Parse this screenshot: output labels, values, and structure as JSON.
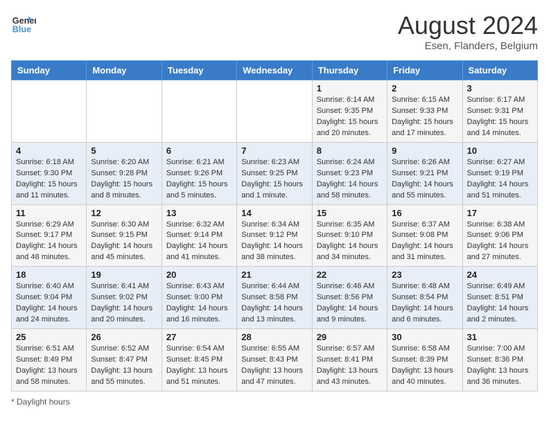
{
  "header": {
    "logo_line1": "General",
    "logo_line2": "Blue",
    "month_year": "August 2024",
    "location": "Esen, Flanders, Belgium"
  },
  "weekdays": [
    "Sunday",
    "Monday",
    "Tuesday",
    "Wednesday",
    "Thursday",
    "Friday",
    "Saturday"
  ],
  "footer": {
    "daylight_label": "Daylight hours"
  },
  "weeks": [
    [
      {
        "day": "",
        "info": ""
      },
      {
        "day": "",
        "info": ""
      },
      {
        "day": "",
        "info": ""
      },
      {
        "day": "",
        "info": ""
      },
      {
        "day": "1",
        "info": "Sunrise: 6:14 AM\nSunset: 9:35 PM\nDaylight: 15 hours\nand 20 minutes."
      },
      {
        "day": "2",
        "info": "Sunrise: 6:15 AM\nSunset: 9:33 PM\nDaylight: 15 hours\nand 17 minutes."
      },
      {
        "day": "3",
        "info": "Sunrise: 6:17 AM\nSunset: 9:31 PM\nDaylight: 15 hours\nand 14 minutes."
      }
    ],
    [
      {
        "day": "4",
        "info": "Sunrise: 6:18 AM\nSunset: 9:30 PM\nDaylight: 15 hours\nand 11 minutes."
      },
      {
        "day": "5",
        "info": "Sunrise: 6:20 AM\nSunset: 9:28 PM\nDaylight: 15 hours\nand 8 minutes."
      },
      {
        "day": "6",
        "info": "Sunrise: 6:21 AM\nSunset: 9:26 PM\nDaylight: 15 hours\nand 5 minutes."
      },
      {
        "day": "7",
        "info": "Sunrise: 6:23 AM\nSunset: 9:25 PM\nDaylight: 15 hours\nand 1 minute."
      },
      {
        "day": "8",
        "info": "Sunrise: 6:24 AM\nSunset: 9:23 PM\nDaylight: 14 hours\nand 58 minutes."
      },
      {
        "day": "9",
        "info": "Sunrise: 6:26 AM\nSunset: 9:21 PM\nDaylight: 14 hours\nand 55 minutes."
      },
      {
        "day": "10",
        "info": "Sunrise: 6:27 AM\nSunset: 9:19 PM\nDaylight: 14 hours\nand 51 minutes."
      }
    ],
    [
      {
        "day": "11",
        "info": "Sunrise: 6:29 AM\nSunset: 9:17 PM\nDaylight: 14 hours\nand 48 minutes."
      },
      {
        "day": "12",
        "info": "Sunrise: 6:30 AM\nSunset: 9:15 PM\nDaylight: 14 hours\nand 45 minutes."
      },
      {
        "day": "13",
        "info": "Sunrise: 6:32 AM\nSunset: 9:14 PM\nDaylight: 14 hours\nand 41 minutes."
      },
      {
        "day": "14",
        "info": "Sunrise: 6:34 AM\nSunset: 9:12 PM\nDaylight: 14 hours\nand 38 minutes."
      },
      {
        "day": "15",
        "info": "Sunrise: 6:35 AM\nSunset: 9:10 PM\nDaylight: 14 hours\nand 34 minutes."
      },
      {
        "day": "16",
        "info": "Sunrise: 6:37 AM\nSunset: 9:08 PM\nDaylight: 14 hours\nand 31 minutes."
      },
      {
        "day": "17",
        "info": "Sunrise: 6:38 AM\nSunset: 9:06 PM\nDaylight: 14 hours\nand 27 minutes."
      }
    ],
    [
      {
        "day": "18",
        "info": "Sunrise: 6:40 AM\nSunset: 9:04 PM\nDaylight: 14 hours\nand 24 minutes."
      },
      {
        "day": "19",
        "info": "Sunrise: 6:41 AM\nSunset: 9:02 PM\nDaylight: 14 hours\nand 20 minutes."
      },
      {
        "day": "20",
        "info": "Sunrise: 6:43 AM\nSunset: 9:00 PM\nDaylight: 14 hours\nand 16 minutes."
      },
      {
        "day": "21",
        "info": "Sunrise: 6:44 AM\nSunset: 8:58 PM\nDaylight: 14 hours\nand 13 minutes."
      },
      {
        "day": "22",
        "info": "Sunrise: 6:46 AM\nSunset: 8:56 PM\nDaylight: 14 hours\nand 9 minutes."
      },
      {
        "day": "23",
        "info": "Sunrise: 6:48 AM\nSunset: 8:54 PM\nDaylight: 14 hours\nand 6 minutes."
      },
      {
        "day": "24",
        "info": "Sunrise: 6:49 AM\nSunset: 8:51 PM\nDaylight: 14 hours\nand 2 minutes."
      }
    ],
    [
      {
        "day": "25",
        "info": "Sunrise: 6:51 AM\nSunset: 8:49 PM\nDaylight: 13 hours\nand 58 minutes."
      },
      {
        "day": "26",
        "info": "Sunrise: 6:52 AM\nSunset: 8:47 PM\nDaylight: 13 hours\nand 55 minutes."
      },
      {
        "day": "27",
        "info": "Sunrise: 6:54 AM\nSunset: 8:45 PM\nDaylight: 13 hours\nand 51 minutes."
      },
      {
        "day": "28",
        "info": "Sunrise: 6:55 AM\nSunset: 8:43 PM\nDaylight: 13 hours\nand 47 minutes."
      },
      {
        "day": "29",
        "info": "Sunrise: 6:57 AM\nSunset: 8:41 PM\nDaylight: 13 hours\nand 43 minutes."
      },
      {
        "day": "30",
        "info": "Sunrise: 6:58 AM\nSunset: 8:39 PM\nDaylight: 13 hours\nand 40 minutes."
      },
      {
        "day": "31",
        "info": "Sunrise: 7:00 AM\nSunset: 8:36 PM\nDaylight: 13 hours\nand 36 minutes."
      }
    ]
  ]
}
